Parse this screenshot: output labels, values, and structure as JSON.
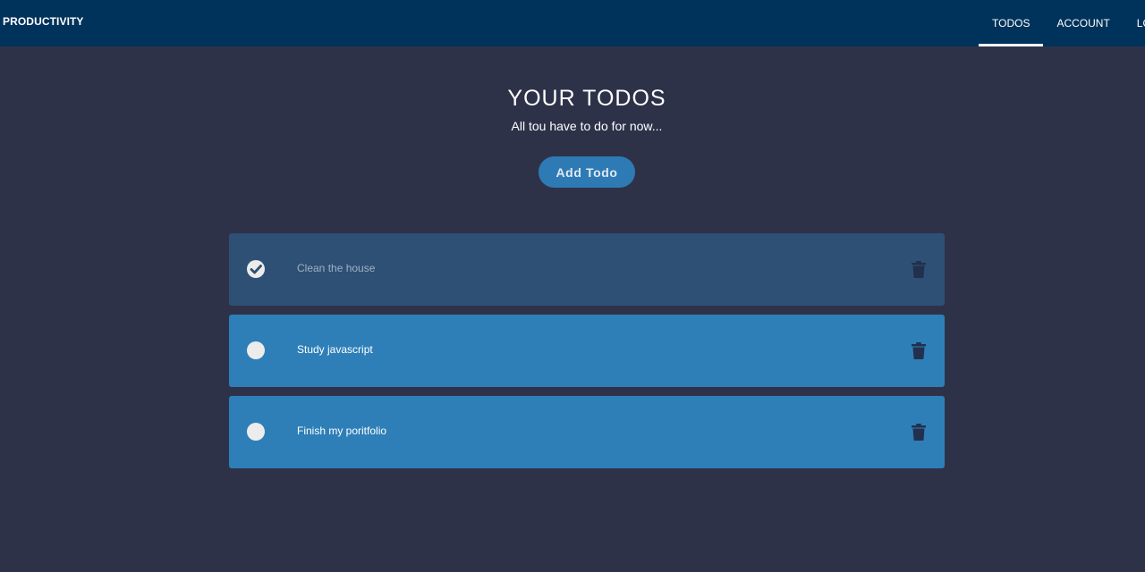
{
  "nav": {
    "brand": "PRODUCTIVITY",
    "links": [
      {
        "label": "TODOS",
        "active": true
      },
      {
        "label": "ACCOUNT",
        "active": false
      },
      {
        "label": "LOGOUT",
        "active": false
      }
    ]
  },
  "header": {
    "title": "YOUR TODOS",
    "subtitle": "All tou have to do for now..."
  },
  "add_button": {
    "label": "Add Todo"
  },
  "todos": [
    {
      "text": "Clean the house",
      "completed": true,
      "check_icon": "check-circle-icon",
      "delete_icon": "trash-icon"
    },
    {
      "text": "Study javascript",
      "completed": false,
      "check_icon": "empty-circle-icon",
      "delete_icon": "trash-icon"
    },
    {
      "text": "Finish my poritfolio",
      "completed": false,
      "check_icon": "empty-circle-icon",
      "delete_icon": "trash-icon"
    }
  ],
  "colors": {
    "navbar": "#00335b",
    "background": "#2e3249",
    "accent": "#2e7ab4",
    "todo_active": "#2e7fb8",
    "todo_done": "#2f5075"
  }
}
